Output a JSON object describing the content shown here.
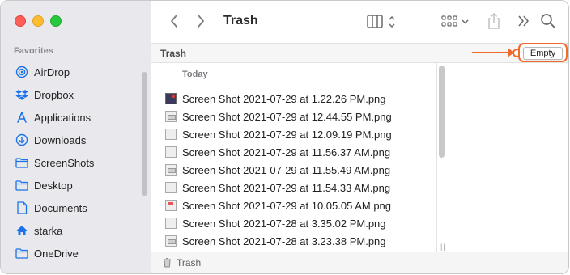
{
  "window": {
    "title": "Trash"
  },
  "sidebar": {
    "section_title": "Favorites",
    "items": [
      {
        "label": "AirDrop",
        "icon": "airdrop-icon"
      },
      {
        "label": "Dropbox",
        "icon": "dropbox-icon"
      },
      {
        "label": "Applications",
        "icon": "applications-icon"
      },
      {
        "label": "Downloads",
        "icon": "downloads-icon"
      },
      {
        "label": "ScreenShots",
        "icon": "folder-icon"
      },
      {
        "label": "Desktop",
        "icon": "folder-icon"
      },
      {
        "label": "Documents",
        "icon": "document-icon"
      },
      {
        "label": "starka",
        "icon": "home-icon"
      },
      {
        "label": "OneDrive",
        "icon": "folder-icon"
      }
    ]
  },
  "pathbar": {
    "title": "Trash",
    "empty_button": "Empty"
  },
  "list": {
    "section": "Today",
    "files": [
      "Screen Shot 2021-07-29 at 1.22.26 PM.png",
      "Screen Shot 2021-07-29 at 12.44.55 PM.png",
      "Screen Shot 2021-07-29 at 12.09.19 PM.png",
      "Screen Shot 2021-07-29 at 11.56.37 AM.png",
      "Screen Shot 2021-07-29 at 11.55.49 AM.png",
      "Screen Shot 2021-07-29 at 11.54.33 AM.png",
      "Screen Shot 2021-07-29 at 10.05.05 AM.png",
      "Screen Shot 2021-07-28 at 3.35.02 PM.png",
      "Screen Shot 2021-07-28 at 3.23.38 PM.png"
    ]
  },
  "status": {
    "label": "Trash"
  },
  "colors": {
    "accent": "#f26a2b",
    "sidebar_icon": "#1a73e8"
  }
}
